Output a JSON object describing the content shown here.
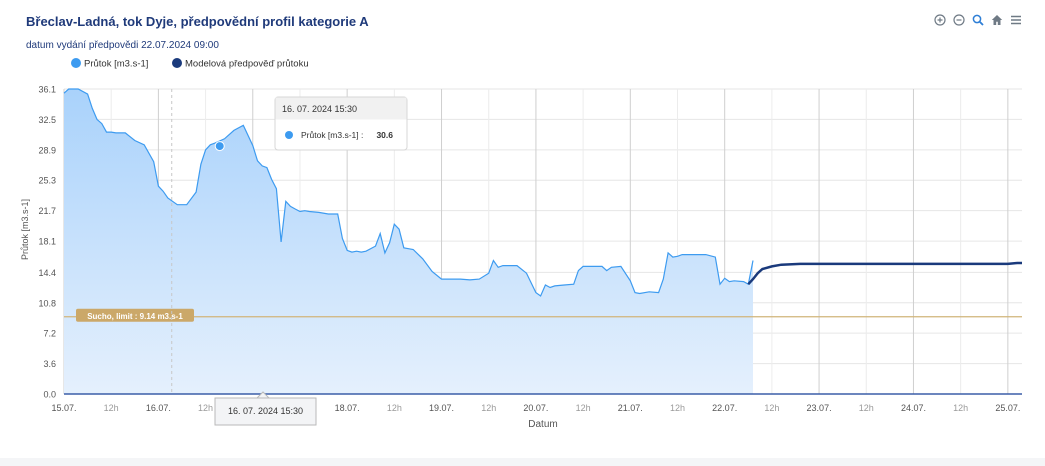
{
  "header": {
    "title": "Břeclav-Ladná, tok Dyje, předpovědní profil kategorie A",
    "subtitle": "datum vydání předpovědi 22.07.2024 09:00"
  },
  "toolbar": [
    {
      "name": "zoom-in-icon"
    },
    {
      "name": "zoom-out-icon"
    },
    {
      "name": "magnifier-icon"
    },
    {
      "name": "home-icon"
    },
    {
      "name": "menu-icon"
    }
  ],
  "colors": {
    "observed": "#3d9bf0",
    "forecast": "#1a3a7c",
    "threshold": "#d1b57a"
  },
  "chart_data": {
    "type": "line",
    "xlabel": "Datum",
    "ylabel": "Průtok [m3.s-1]",
    "yticks": [
      "0.0",
      "3.6",
      "7.2",
      "10.8",
      "14.4",
      "18.1",
      "21.7",
      "25.3",
      "28.9",
      "32.5",
      "36.1"
    ],
    "ylim": [
      0,
      36.1
    ],
    "x_range_days": [
      15.0,
      25.15
    ],
    "xticks": [
      {
        "d": 15.0,
        "label": "15.07.",
        "major": true
      },
      {
        "d": 15.5,
        "label": "12h",
        "major": false
      },
      {
        "d": 16.0,
        "label": "16.07.",
        "major": true
      },
      {
        "d": 16.5,
        "label": "12h",
        "major": false
      },
      {
        "d": 17.0,
        "label": "",
        "major": true
      },
      {
        "d": 17.5,
        "label": "",
        "major": false
      },
      {
        "d": 18.0,
        "label": "18.07.",
        "major": true
      },
      {
        "d": 18.5,
        "label": "12h",
        "major": false
      },
      {
        "d": 19.0,
        "label": "19.07.",
        "major": true
      },
      {
        "d": 19.5,
        "label": "12h",
        "major": false
      },
      {
        "d": 20.0,
        "label": "20.07.",
        "major": true
      },
      {
        "d": 20.5,
        "label": "12h",
        "major": false
      },
      {
        "d": 21.0,
        "label": "21.07.",
        "major": true
      },
      {
        "d": 21.5,
        "label": "12h",
        "major": false
      },
      {
        "d": 22.0,
        "label": "22.07.",
        "major": true
      },
      {
        "d": 22.5,
        "label": "12h",
        "major": false
      },
      {
        "d": 23.0,
        "label": "23.07.",
        "major": true
      },
      {
        "d": 23.5,
        "label": "12h",
        "major": false
      },
      {
        "d": 24.0,
        "label": "24.07.",
        "major": true
      },
      {
        "d": 24.5,
        "label": "12h",
        "major": false
      },
      {
        "d": 25.0,
        "label": "25.07.",
        "major": true
      }
    ],
    "series": [
      {
        "name": "Průtok [m3.s-1]",
        "kind": "area",
        "x": [
          15.0,
          15.05,
          15.15,
          15.25,
          15.3,
          15.35,
          15.4,
          15.45,
          15.5,
          15.55,
          15.65,
          15.75,
          15.85,
          15.95,
          16.0,
          16.05,
          16.1,
          16.2,
          16.3,
          16.4,
          16.45,
          16.5,
          16.55,
          16.6,
          16.7,
          16.8,
          16.9,
          17.0,
          17.05,
          17.1,
          17.15,
          17.2,
          17.25,
          17.3,
          17.35,
          17.4,
          17.45,
          17.5,
          17.55,
          17.6,
          17.7,
          17.8,
          17.9,
          17.95,
          18.0,
          18.05,
          18.1,
          18.15,
          18.2,
          18.3,
          18.35,
          18.4,
          18.45,
          18.5,
          18.55,
          18.6,
          18.65,
          18.7,
          18.8,
          18.9,
          19.0,
          19.1,
          19.2,
          19.3,
          19.4,
          19.5,
          19.55,
          19.6,
          19.65,
          19.7,
          19.8,
          19.9,
          20.0,
          20.05,
          20.1,
          20.15,
          20.2,
          20.3,
          20.4,
          20.45,
          20.5,
          20.6,
          20.7,
          20.75,
          20.8,
          20.9,
          21.0,
          21.05,
          21.1,
          21.2,
          21.3,
          21.35,
          21.4,
          21.45,
          21.5,
          21.55,
          21.6,
          21.7,
          21.8,
          21.9,
          21.95,
          22.0,
          22.05,
          22.1,
          22.2,
          22.25,
          22.3
        ],
        "values": [
          35.6,
          36.1,
          36.1,
          35.5,
          33.8,
          32.5,
          32.0,
          31.0,
          31.0,
          30.9,
          30.9,
          30.0,
          29.5,
          27.5,
          24.6,
          24.0,
          23.2,
          22.4,
          22.4,
          23.9,
          27.2,
          28.9,
          29.5,
          29.7,
          30.2,
          31.2,
          31.8,
          29.4,
          27.6,
          27.0,
          26.8,
          25.4,
          24.3,
          18.0,
          22.8,
          22.2,
          21.9,
          21.6,
          21.7,
          21.6,
          21.5,
          21.3,
          21.3,
          18.4,
          17.0,
          16.8,
          16.9,
          16.8,
          16.9,
          17.5,
          19.0,
          16.7,
          17.9,
          20.1,
          19.5,
          17.3,
          17.2,
          17.1,
          16.0,
          14.5,
          13.6,
          13.6,
          13.6,
          13.5,
          13.6,
          14.3,
          15.8,
          15.0,
          15.2,
          15.2,
          15.2,
          14.3,
          12.0,
          11.6,
          12.9,
          12.6,
          12.8,
          12.9,
          13.0,
          14.6,
          15.1,
          15.1,
          15.1,
          14.6,
          15.0,
          15.1,
          13.4,
          12.0,
          11.9,
          12.1,
          12.0,
          13.6,
          16.7,
          16.2,
          16.3,
          16.5,
          16.5,
          16.5,
          16.5,
          16.2,
          13.0,
          13.7,
          13.3,
          13.4,
          13.3,
          13.0,
          15.8
        ]
      },
      {
        "name": "Modelová předpověď průtoku",
        "kind": "line",
        "x": [
          22.25,
          22.3,
          22.35,
          22.4,
          22.5,
          22.6,
          22.8,
          23.0,
          23.5,
          24.0,
          24.5,
          25.0,
          25.1,
          25.15
        ],
        "values": [
          13.0,
          13.6,
          14.3,
          14.8,
          15.1,
          15.3,
          15.4,
          15.4,
          15.4,
          15.4,
          15.4,
          15.4,
          15.5,
          15.5
        ]
      }
    ],
    "threshold": {
      "label": "Sucho, limit : 9.14 m3.s-1",
      "value": 9.14
    },
    "tooltip": {
      "header": "16. 07. 2024 15:30",
      "series": "Průtok [m3.s-1] :",
      "value": "30.6",
      "d": 16.65
    },
    "crosshair_label": "16. 07. 2024 15:30",
    "legend": [
      {
        "name": "Průtok [m3.s-1]"
      },
      {
        "name": "Modelová předpověď průtoku"
      }
    ],
    "legend_position": "top-left"
  }
}
